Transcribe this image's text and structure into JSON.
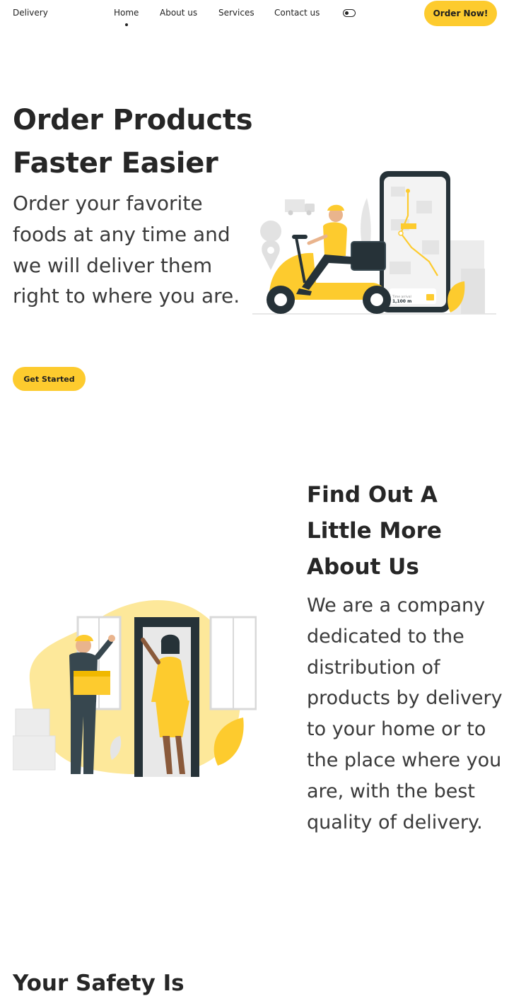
{
  "header": {
    "logo": "Delivery",
    "nav": [
      "Home",
      "About us",
      "Services",
      "Contact us"
    ],
    "order_button": "Order Now!",
    "theme_toggle_icon": "toggle-icon"
  },
  "hero": {
    "title_line1": "Order Products",
    "title_line2": "Faster Easier",
    "description": "Order your favorite foods at any time and we will deliver them right to where you are.",
    "button": "Get Started",
    "phone_distance": "1,100 m",
    "phone_label": "Time arrival"
  },
  "about": {
    "title_line1": "Find Out A Little More",
    "title_line2": "About Us",
    "description": "We are a company dedicated to the distribution of products by delivery to your home or to the place where you are, with the best quality of delivery."
  },
  "safety": {
    "title": "Your Safety Is"
  },
  "colors": {
    "accent": "#fdcb2e",
    "dark": "#263238",
    "text": "#262626"
  }
}
